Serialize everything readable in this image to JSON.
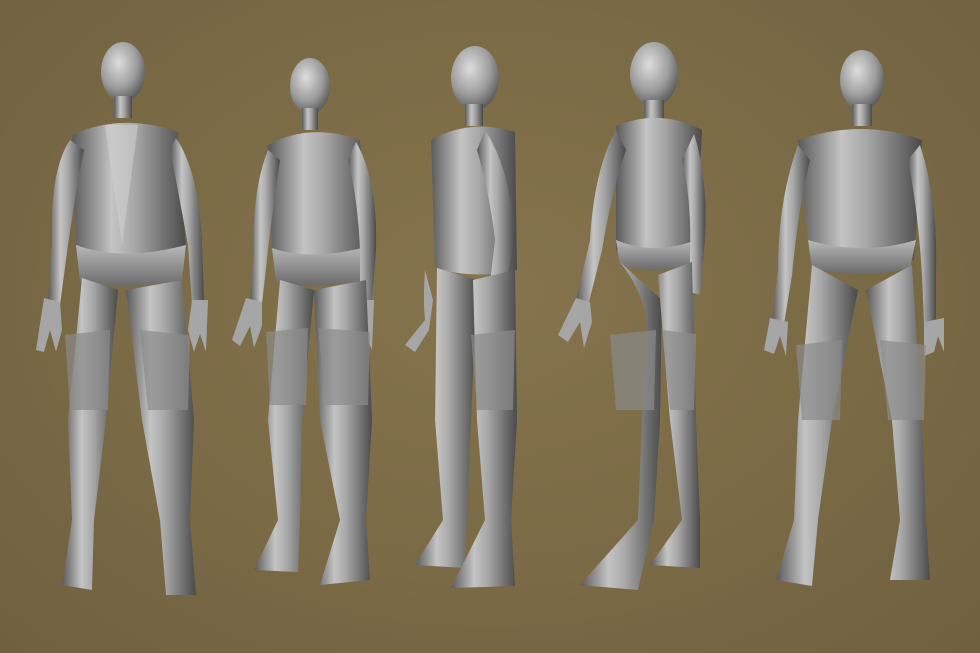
{
  "scene": {
    "background_color": "#7a6a45",
    "model_color": "#9a9a9a",
    "model_highlight": "#d8d8d8",
    "model_shadow": "#4e4e4e"
  },
  "views": [
    {
      "id": "front",
      "icon": "sculpt-figure-front"
    },
    {
      "id": "three-quarter-front",
      "icon": "sculpt-figure-three-quarter"
    },
    {
      "id": "side",
      "icon": "sculpt-figure-side"
    },
    {
      "id": "three-quarter-back",
      "icon": "sculpt-figure-back-three-quarter"
    },
    {
      "id": "back",
      "icon": "sculpt-figure-back"
    }
  ]
}
